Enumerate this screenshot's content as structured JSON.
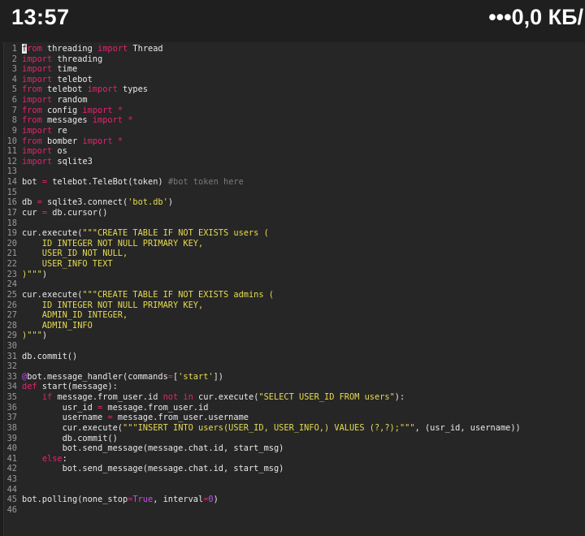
{
  "status_bar": {
    "time": "13:57",
    "network": "•••0,0 КБ/"
  },
  "editor": {
    "colors": {
      "keyword": "#e2246f",
      "string": "#e6db52",
      "comment": "#7a7a7a",
      "decorator": "#c24ee8",
      "text": "#e8e8e8",
      "background": "#262626"
    },
    "lines": [
      {
        "n": "1",
        "t": [
          {
            "c": "cursor",
            "s": "f"
          },
          {
            "c": "kw",
            "s": "rom"
          },
          {
            "s": " threading "
          },
          {
            "c": "kw",
            "s": "import"
          },
          {
            "s": " Thread"
          }
        ]
      },
      {
        "n": "2",
        "t": [
          {
            "c": "kw",
            "s": "import"
          },
          {
            "s": " threading"
          }
        ]
      },
      {
        "n": "3",
        "t": [
          {
            "c": "kw",
            "s": "import"
          },
          {
            "s": " time"
          }
        ]
      },
      {
        "n": "4",
        "t": [
          {
            "c": "kw",
            "s": "import"
          },
          {
            "s": " telebot"
          }
        ]
      },
      {
        "n": "5",
        "t": [
          {
            "c": "kw",
            "s": "from"
          },
          {
            "s": " telebot "
          },
          {
            "c": "kw",
            "s": "import"
          },
          {
            "s": " types"
          }
        ]
      },
      {
        "n": "6",
        "t": [
          {
            "c": "kw",
            "s": "import"
          },
          {
            "s": " random"
          }
        ]
      },
      {
        "n": "7",
        "t": [
          {
            "c": "kw",
            "s": "from"
          },
          {
            "s": " config "
          },
          {
            "c": "kw",
            "s": "import *"
          }
        ]
      },
      {
        "n": "8",
        "t": [
          {
            "c": "kw",
            "s": "from"
          },
          {
            "s": " messages "
          },
          {
            "c": "kw",
            "s": "import *"
          }
        ]
      },
      {
        "n": "9",
        "t": [
          {
            "c": "kw",
            "s": "import"
          },
          {
            "s": " re"
          }
        ]
      },
      {
        "n": "10",
        "t": [
          {
            "c": "kw",
            "s": "from"
          },
          {
            "s": " bomber "
          },
          {
            "c": "kw",
            "s": "import *"
          }
        ]
      },
      {
        "n": "11",
        "t": [
          {
            "c": "kw",
            "s": "import"
          },
          {
            "s": " os"
          }
        ]
      },
      {
        "n": "12",
        "t": [
          {
            "c": "kw",
            "s": "import"
          },
          {
            "s": " sqlite3"
          }
        ]
      },
      {
        "n": "13",
        "t": []
      },
      {
        "n": "14",
        "t": [
          {
            "s": "bot "
          },
          {
            "c": "kw",
            "s": "="
          },
          {
            "s": " telebot.TeleBot(token) "
          },
          {
            "c": "cm",
            "s": "#bot token here"
          }
        ]
      },
      {
        "n": "15",
        "t": []
      },
      {
        "n": "16",
        "t": [
          {
            "s": "db "
          },
          {
            "c": "kw",
            "s": "="
          },
          {
            "s": " sqlite3.connect("
          },
          {
            "c": "str",
            "s": "'bot.db'"
          },
          {
            "s": ")"
          }
        ]
      },
      {
        "n": "17",
        "t": [
          {
            "s": "cur "
          },
          {
            "c": "kw",
            "s": "="
          },
          {
            "s": " db.cursor()"
          }
        ]
      },
      {
        "n": "18",
        "t": []
      },
      {
        "n": "19",
        "t": [
          {
            "s": "cur.execute("
          },
          {
            "c": "str",
            "s": "\"\"\"CREATE TABLE IF NOT EXISTS users ("
          }
        ]
      },
      {
        "n": "20",
        "t": [
          {
            "c": "str",
            "s": "    ID INTEGER NOT NULL PRIMARY KEY,"
          }
        ]
      },
      {
        "n": "21",
        "t": [
          {
            "c": "str",
            "s": "    USER_ID NOT NULL,"
          }
        ]
      },
      {
        "n": "22",
        "t": [
          {
            "c": "str",
            "s": "    USER_INFO TEXT"
          }
        ]
      },
      {
        "n": "23",
        "t": [
          {
            "c": "str",
            "s": ")\"\"\""
          },
          {
            "s": ")"
          }
        ]
      },
      {
        "n": "24",
        "t": []
      },
      {
        "n": "25",
        "t": [
          {
            "s": "cur.execute("
          },
          {
            "c": "str",
            "s": "\"\"\"CREATE TABLE IF NOT EXISTS admins ("
          }
        ]
      },
      {
        "n": "26",
        "t": [
          {
            "c": "str",
            "s": "    ID INTEGER NOT NULL PRIMARY KEY,"
          }
        ]
      },
      {
        "n": "27",
        "t": [
          {
            "c": "str",
            "s": "    ADMIN_ID INTEGER,"
          }
        ]
      },
      {
        "n": "28",
        "t": [
          {
            "c": "str",
            "s": "    ADMIN_INFO"
          }
        ]
      },
      {
        "n": "29",
        "t": [
          {
            "c": "str",
            "s": ")\"\"\""
          },
          {
            "s": ")"
          }
        ]
      },
      {
        "n": "30",
        "t": []
      },
      {
        "n": "31",
        "t": [
          {
            "s": "db.commit()"
          }
        ]
      },
      {
        "n": "32",
        "t": []
      },
      {
        "n": "33",
        "t": [
          {
            "c": "cl",
            "s": "@"
          },
          {
            "s": "bot.message_handler(commands"
          },
          {
            "c": "kw",
            "s": "="
          },
          {
            "s": "["
          },
          {
            "c": "str",
            "s": "'start'"
          },
          {
            "s": "])"
          }
        ]
      },
      {
        "n": "34",
        "t": [
          {
            "c": "kw",
            "s": "def"
          },
          {
            "s": " start(message):"
          }
        ]
      },
      {
        "n": "35",
        "t": [
          {
            "s": "    "
          },
          {
            "c": "kw",
            "s": "if"
          },
          {
            "s": " message.from_user.id "
          },
          {
            "c": "kw",
            "s": "not in"
          },
          {
            "s": " cur.execute("
          },
          {
            "c": "str",
            "s": "\"SELECT USER_ID FROM users\""
          },
          {
            "s": "):"
          }
        ]
      },
      {
        "n": "36",
        "t": [
          {
            "s": "        usr_id "
          },
          {
            "c": "kw",
            "s": "="
          },
          {
            "s": " message.from_user.id"
          }
        ]
      },
      {
        "n": "37",
        "t": [
          {
            "s": "        username "
          },
          {
            "c": "kw",
            "s": "="
          },
          {
            "s": " message.from_user.username"
          }
        ]
      },
      {
        "n": "38",
        "t": [
          {
            "s": "        cur.execute("
          },
          {
            "c": "str",
            "s": "\"\"\"INSERT INTO users(USER_ID, USER_INFO,) VALUES (?,?);\"\"\""
          },
          {
            "s": ", (usr_id, username))"
          }
        ]
      },
      {
        "n": "39",
        "t": [
          {
            "s": "        db.commit()"
          }
        ]
      },
      {
        "n": "40",
        "t": [
          {
            "s": "        bot.send_message(message.chat.id, start_msg)"
          }
        ]
      },
      {
        "n": "41",
        "t": [
          {
            "s": "    "
          },
          {
            "c": "kw",
            "s": "else"
          },
          {
            "s": ":"
          }
        ]
      },
      {
        "n": "42",
        "t": [
          {
            "s": "        bot.send_message(message.chat.id, start_msg)"
          }
        ]
      },
      {
        "n": "43",
        "t": []
      },
      {
        "n": "44",
        "t": []
      },
      {
        "n": "45",
        "t": [
          {
            "s": "bot.polling(none_stop"
          },
          {
            "c": "kw",
            "s": "="
          },
          {
            "c": "cl",
            "s": "True"
          },
          {
            "s": ", interval"
          },
          {
            "c": "kw",
            "s": "="
          },
          {
            "c": "cl",
            "s": "0"
          },
          {
            "s": ")"
          }
        ]
      },
      {
        "n": "46",
        "t": []
      }
    ]
  }
}
